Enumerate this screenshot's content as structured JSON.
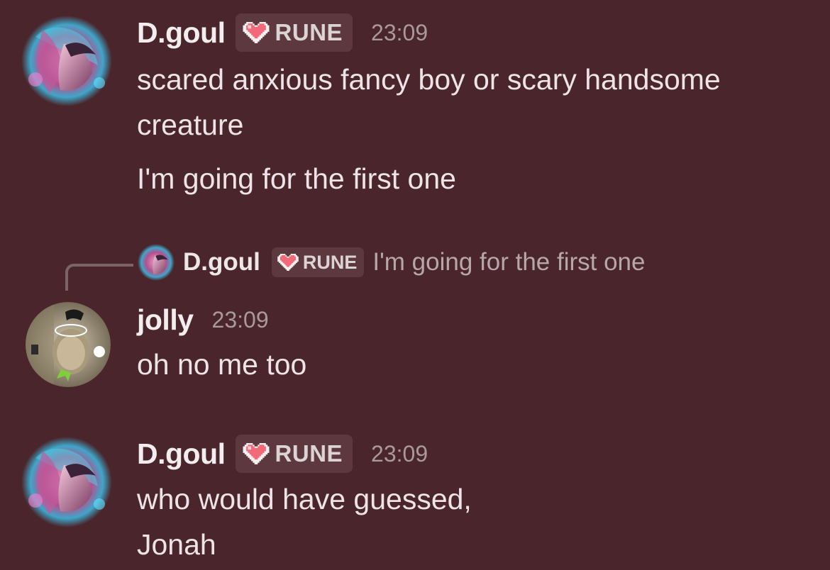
{
  "messages": [
    {
      "username": "D.goul",
      "tag": "RUNE",
      "timestamp": "23:09",
      "lines": [
        "scared anxious fancy boy or scary handsome",
        "creature"
      ],
      "extra": "I'm going for the first one",
      "avatar": "dgoul-avatar"
    },
    {
      "reply": {
        "username": "D.goul",
        "tag": "RUNE",
        "text": "I'm going for the first one"
      },
      "username": "jolly",
      "timestamp": "23:09",
      "lines": [
        "oh no me too"
      ],
      "avatar": "jolly-avatar"
    },
    {
      "username": "D.goul",
      "tag": "RUNE",
      "timestamp": "23:09",
      "lines": [
        "who would have guessed,",
        "Jonah"
      ],
      "avatar": "dgoul-avatar"
    }
  ],
  "icons": {
    "tag_icon": "pixel-heart-icon"
  },
  "colors": {
    "background": "#4a252b",
    "tag_bg": "#5d383e",
    "timestamp": "#a8999c",
    "heart": "#f26a7a"
  }
}
